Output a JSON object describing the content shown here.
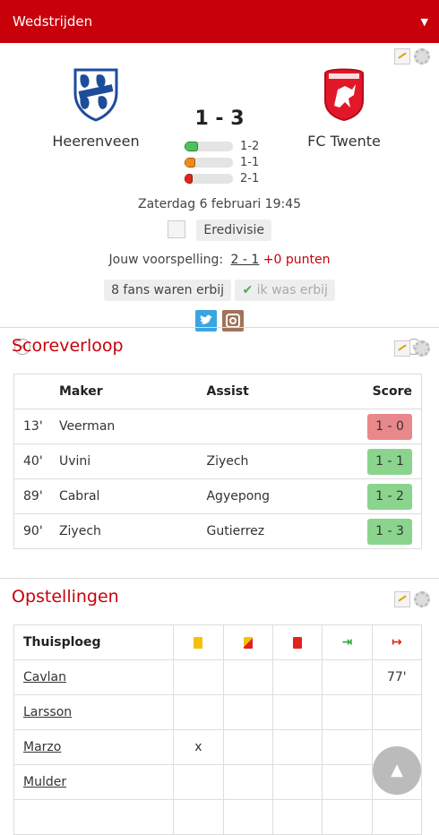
{
  "header": {
    "title": "Wedstrijden",
    "caret": "▼"
  },
  "match": {
    "home": {
      "name": "Heerenveen"
    },
    "away": {
      "name": "FC Twente"
    },
    "score": "1 - 3",
    "predictions": [
      {
        "label": "1-2",
        "color": "#4cc35a",
        "percent": 28
      },
      {
        "label": "1-1",
        "color": "#f08a1c",
        "percent": 22
      },
      {
        "label": "2-1",
        "color": "#e0251b",
        "percent": 17
      }
    ],
    "datetime": "Zaterdag 6 februari 19:45",
    "competition": "Eredivisie",
    "prediction_label": "Jouw voorspelling:",
    "prediction_value": "2 - 1",
    "prediction_points": "+0 punten",
    "fans": "8 fans waren erbij",
    "was_there": "ik was erbij",
    "prev": "‹",
    "next": "›"
  },
  "scoreverloop": {
    "title": "Scoreverloop",
    "columns": {
      "maker": "Maker",
      "assist": "Assist",
      "score": "Score"
    },
    "rows": [
      {
        "minute": "13'",
        "maker": "Veerman",
        "assist": "",
        "score": "1 - 0",
        "color": "#e8888a"
      },
      {
        "minute": "40'",
        "maker": "Uvini",
        "assist": "Ziyech",
        "score": "1 - 1",
        "color": "#8bd48d"
      },
      {
        "minute": "89'",
        "maker": "Cabral",
        "assist": "Agyepong",
        "score": "1 - 2",
        "color": "#8bd48d"
      },
      {
        "minute": "90'",
        "maker": "Ziyech",
        "assist": "Gutierrez",
        "score": "1 - 3",
        "color": "#8bd48d"
      }
    ]
  },
  "opstellingen": {
    "title": "Opstellingen",
    "team_label": "Thuisploeg",
    "players": [
      {
        "name": "Cavlan",
        "yellow": "",
        "second_yellow": "",
        "red": "",
        "sub_in": "",
        "sub_out": "77'"
      },
      {
        "name": "Larsson",
        "yellow": "",
        "second_yellow": "",
        "red": "",
        "sub_in": "",
        "sub_out": ""
      },
      {
        "name": "Marzo",
        "yellow": "x",
        "second_yellow": "",
        "red": "",
        "sub_in": "",
        "sub_out": ""
      },
      {
        "name": "Mulder",
        "yellow": "",
        "second_yellow": "",
        "red": "",
        "sub_in": "",
        "sub_out": ""
      },
      {
        "name": "",
        "yellow": "",
        "second_yellow": "",
        "red": "",
        "sub_in": "",
        "sub_out": ""
      }
    ]
  },
  "scroll_top": "▲"
}
